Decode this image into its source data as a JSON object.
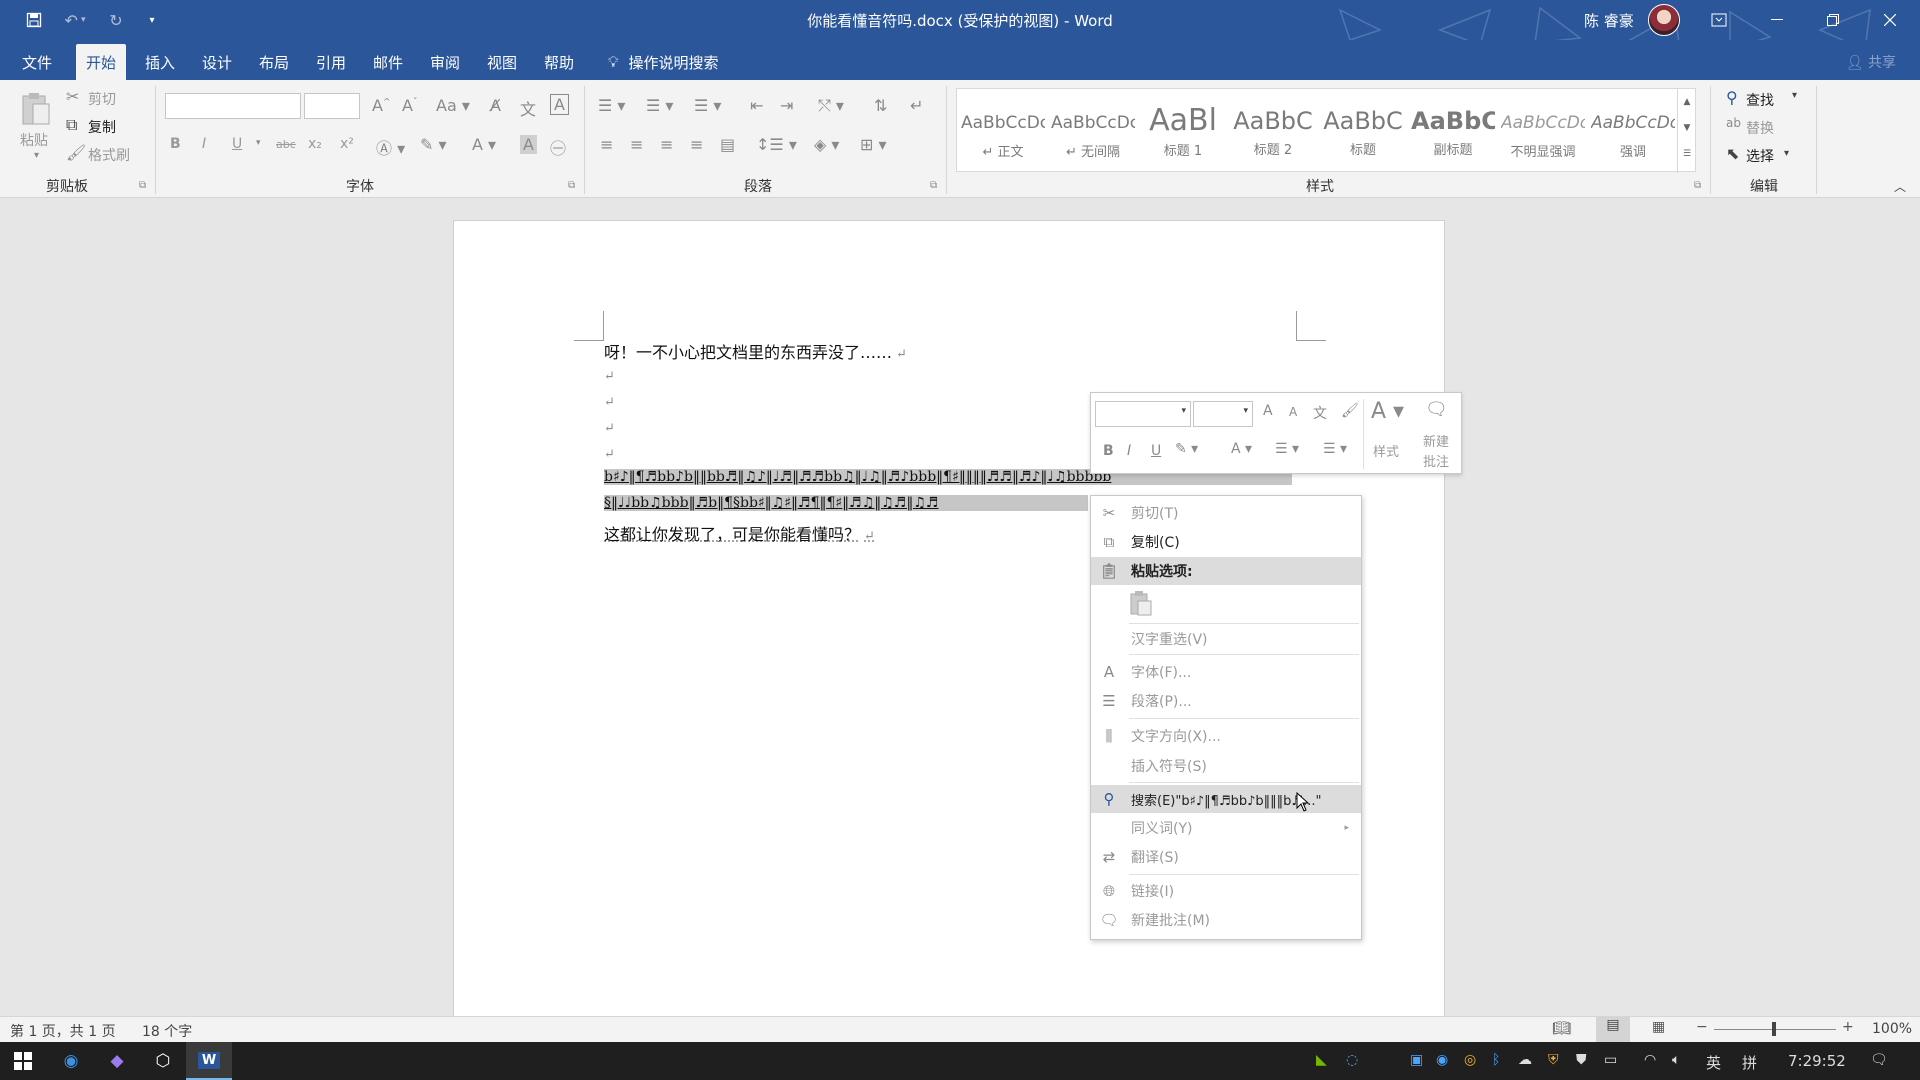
{
  "titlebar": {
    "title": "你能看懂音符吗.docx (受保护的视图) - Word",
    "user": "陈 睿豪",
    "quick_access": [
      "save-icon",
      "undo-icon",
      "redo-icon",
      "customize-icon"
    ]
  },
  "tabs": [
    "文件",
    "开始",
    "插入",
    "设计",
    "布局",
    "引用",
    "邮件",
    "审阅",
    "视图",
    "帮助"
  ],
  "active_tab": "开始",
  "tell_me": "操作说明搜索",
  "share": "共享",
  "ribbon": {
    "clipboard": {
      "label": "剪贴板",
      "paste": "粘贴",
      "cut": "剪切",
      "copy": "复制",
      "format_painter": "格式刷"
    },
    "font": {
      "label": "字体",
      "bold": "B",
      "italic": "I",
      "underline": "U",
      "strike": "abc",
      "sub": "x₂",
      "sup": "x²"
    },
    "paragraph": {
      "label": "段落"
    },
    "styles": {
      "label": "样式",
      "items": [
        {
          "preview": "AaBbCcDc",
          "name": "↵ 正文"
        },
        {
          "preview": "AaBbCcDc",
          "name": "↵ 无间隔"
        },
        {
          "preview": "AaBl",
          "name": "标题 1"
        },
        {
          "preview": "AaBbC",
          "name": "标题 2"
        },
        {
          "preview": "AaBbC",
          "name": "标题"
        },
        {
          "preview": "AaBbC",
          "name": "副标题"
        },
        {
          "preview": "AaBbCcDc",
          "name": "不明显强调"
        },
        {
          "preview": "AaBbCcDc",
          "name": "强调"
        }
      ]
    },
    "editing": {
      "label": "编辑",
      "find": "查找",
      "replace": "替换",
      "select": "选择"
    }
  },
  "document": {
    "line1": "呀！一不小心把文档里的东西弄没了……",
    "selected1": "b♯♪‖¶♬bb♪b‖‖bb♬‖♫♪‖♩♬‖♬♬bb♫‖♩♫‖♬♪bbb‖¶♯‖‖‖‖♬♬‖♬♪‖♩♫bbbbb",
    "selected2": "§‖♩♩bb♫bbb‖♬b‖¶§bb♯‖♫♯‖♬¶‖¶♯‖♬♫‖♫♬‖♫♬",
    "line_last": "这都让你发现了，可是你能看懂吗？",
    "para_mark": "↵"
  },
  "mini_toolbar": {
    "styles": "样式",
    "new_comment_1": "新建",
    "new_comment_2": "批注"
  },
  "context_menu": [
    {
      "label": "剪切(T)",
      "icon": "cut-icon",
      "enabled": false
    },
    {
      "label": "复制(C)",
      "icon": "copy-icon",
      "enabled": true
    },
    {
      "label": "粘贴选项:",
      "icon": "paste-icon",
      "enabled": true
    },
    {
      "label": "汉字重选(V)",
      "icon": "",
      "enabled": false
    },
    {
      "label": "字体(F)...",
      "icon": "font-icon",
      "enabled": false
    },
    {
      "label": "段落(P)...",
      "icon": "paragraph-icon",
      "enabled": false
    },
    {
      "label": "文字方向(X)...",
      "icon": "text-direction-icon",
      "enabled": false
    },
    {
      "label": "插入符号(S)",
      "icon": "",
      "enabled": false
    },
    {
      "label": "搜索(E)\"b♯♪‖¶♬bb♪b‖‖‖b♬...\"",
      "icon": "search-icon",
      "enabled": true
    },
    {
      "label": "同义词(Y)",
      "icon": "",
      "enabled": false
    },
    {
      "label": "翻译(S)",
      "icon": "translate-icon",
      "enabled": false
    },
    {
      "label": "链接(I)",
      "icon": "link-icon",
      "enabled": false
    },
    {
      "label": "新建批注(M)",
      "icon": "comment-icon",
      "enabled": false
    }
  ],
  "statusbar": {
    "page": "第 1 页，共 1 页",
    "words": "18 个字",
    "zoom": "100%"
  },
  "taskbar": {
    "ime_lang": "英",
    "ime_mode": "拼",
    "time": "7:29:52"
  }
}
